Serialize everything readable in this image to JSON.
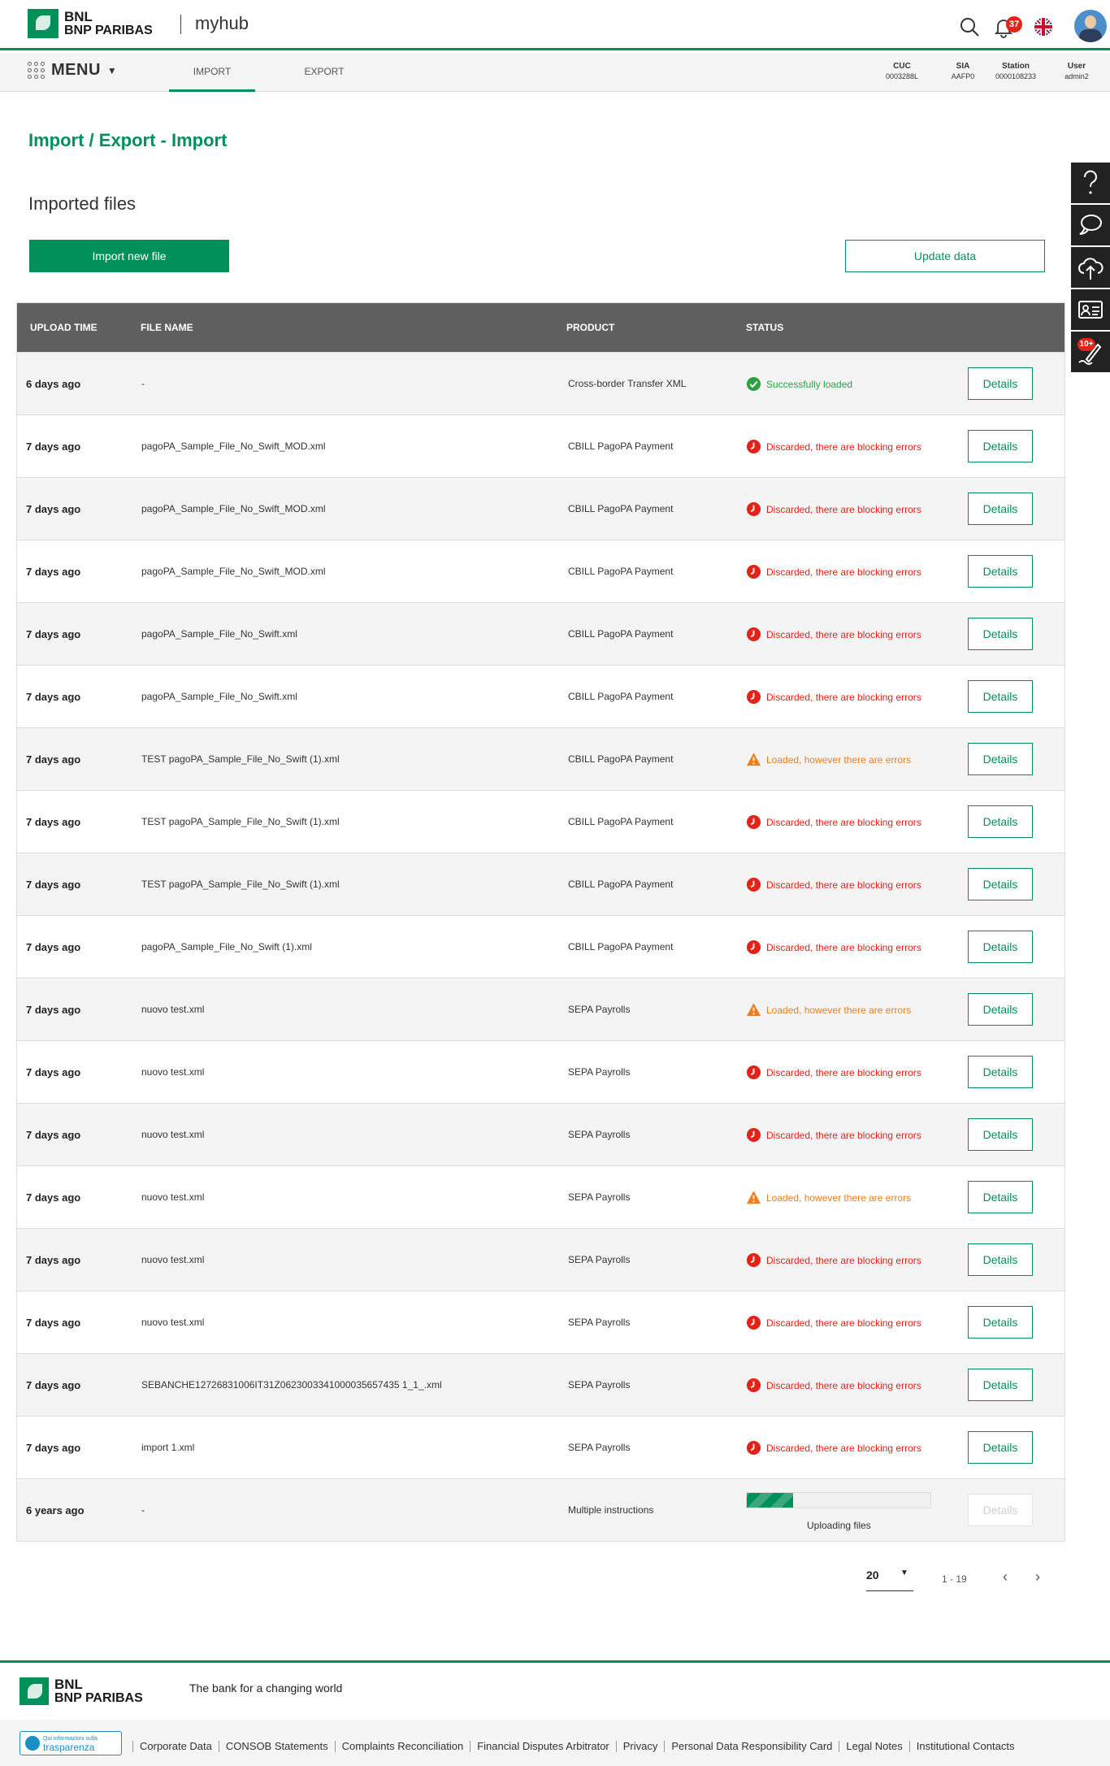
{
  "header": {
    "logo_line1": "BNL",
    "logo_line2": "BNP PARIBAS",
    "app_name": "myhub",
    "notifications_count": "37",
    "icons": [
      "search-icon",
      "bell-icon",
      "uk-flag-icon",
      "avatar"
    ]
  },
  "nav": {
    "menu_label": "MENU",
    "tabs": [
      {
        "label": "IMPORT",
        "active": true
      },
      {
        "label": "EXPORT",
        "active": false
      }
    ],
    "info": [
      {
        "label": "CUC",
        "value": "0003288L"
      },
      {
        "label": "SIA",
        "value": "AAFP0"
      },
      {
        "label": "Station",
        "value": "0000108233"
      },
      {
        "label": "User",
        "value": "admin2"
      }
    ]
  },
  "page": {
    "title": "Import / Export - Import",
    "section_title": "Imported files",
    "import_button": "Import new file",
    "update_button": "Update data"
  },
  "table": {
    "headers": {
      "upload_time": "UPLOAD TIME",
      "file_name": "FILE NAME",
      "product": "PRODUCT",
      "status": "STATUS"
    },
    "details_label": "Details",
    "rows": [
      {
        "time": "6 days ago",
        "file": "-",
        "product": "Cross-border Transfer XML",
        "status": "Successfully loaded",
        "type": "ok"
      },
      {
        "time": "7 days ago",
        "file": "pagoPA_Sample_File_No_Swift_MOD.xml",
        "product": "CBILL PagoPA Payment",
        "status": "Discarded, there are blocking errors",
        "type": "err"
      },
      {
        "time": "7 days ago",
        "file": "pagoPA_Sample_File_No_Swift_MOD.xml",
        "product": "CBILL PagoPA Payment",
        "status": "Discarded, there are blocking errors",
        "type": "err"
      },
      {
        "time": "7 days ago",
        "file": "pagoPA_Sample_File_No_Swift_MOD.xml",
        "product": "CBILL PagoPA Payment",
        "status": "Discarded, there are blocking errors",
        "type": "err"
      },
      {
        "time": "7 days ago",
        "file": "pagoPA_Sample_File_No_Swift.xml",
        "product": "CBILL PagoPA Payment",
        "status": "Discarded, there are blocking errors",
        "type": "err"
      },
      {
        "time": "7 days ago",
        "file": "pagoPA_Sample_File_No_Swift.xml",
        "product": "CBILL PagoPA Payment",
        "status": "Discarded, there are blocking errors",
        "type": "err"
      },
      {
        "time": "7 days ago",
        "file": "TEST pagoPA_Sample_File_No_Swift (1).xml",
        "product": "CBILL PagoPA Payment",
        "status": "Loaded, however there are errors",
        "type": "warn"
      },
      {
        "time": "7 days ago",
        "file": "TEST pagoPA_Sample_File_No_Swift (1).xml",
        "product": "CBILL PagoPA Payment",
        "status": "Discarded, there are blocking errors",
        "type": "err"
      },
      {
        "time": "7 days ago",
        "file": "TEST pagoPA_Sample_File_No_Swift (1).xml",
        "product": "CBILL PagoPA Payment",
        "status": "Discarded, there are blocking errors",
        "type": "err"
      },
      {
        "time": "7 days ago",
        "file": "pagoPA_Sample_File_No_Swift (1).xml",
        "product": "CBILL PagoPA Payment",
        "status": "Discarded, there are blocking errors",
        "type": "err"
      },
      {
        "time": "7 days ago",
        "file": "nuovo test.xml",
        "product": "SEPA Payrolls",
        "status": "Loaded, however there are errors",
        "type": "warn"
      },
      {
        "time": "7 days ago",
        "file": "nuovo test.xml",
        "product": "SEPA Payrolls",
        "status": "Discarded, there are blocking errors",
        "type": "err"
      },
      {
        "time": "7 days ago",
        "file": "nuovo test.xml",
        "product": "SEPA Payrolls",
        "status": "Discarded, there are blocking errors",
        "type": "err"
      },
      {
        "time": "7 days ago",
        "file": "nuovo test.xml",
        "product": "SEPA Payrolls",
        "status": "Loaded, however there are errors",
        "type": "warn"
      },
      {
        "time": "7 days ago",
        "file": "nuovo test.xml",
        "product": "SEPA Payrolls",
        "status": "Discarded, there are blocking errors",
        "type": "err"
      },
      {
        "time": "7 days ago",
        "file": "nuovo test.xml",
        "product": "SEPA Payrolls",
        "status": "Discarded, there are blocking errors",
        "type": "err"
      },
      {
        "time": "7 days ago",
        "file": "SEBANCHE12726831006IT31Z0623003341000035657435 1_1_.xml",
        "product": "SEPA Payrolls",
        "status": "Discarded, there are blocking errors",
        "type": "err"
      },
      {
        "time": "7 days ago",
        "file": "import 1.xml",
        "product": "SEPA Payrolls",
        "status": "Discarded, there are blocking errors",
        "type": "err"
      },
      {
        "time": "6 years ago",
        "file": "-",
        "product": "Multiple instructions",
        "status": "Uploading files",
        "type": "progress",
        "progress": 0.25
      }
    ]
  },
  "pagination": {
    "page_size": "20",
    "range": "1 - 19"
  },
  "sidebar": {
    "items": [
      {
        "icon": "help-icon"
      },
      {
        "icon": "chat-icon"
      },
      {
        "icon": "cloud-upload-icon"
      },
      {
        "icon": "id-card-icon"
      },
      {
        "icon": "signature-icon",
        "badge": "10+"
      }
    ]
  },
  "footer": {
    "tagline": "The bank for a changing world",
    "trasparenza_small": "Qui informazioni sulla",
    "trasparenza_big": "trasparenza",
    "links": [
      "Corporate Data",
      "CONSOB Statements",
      "Complaints Reconciliation",
      "Financial Disputes Arbitrator",
      "Privacy",
      "Personal Data Responsibility Card",
      "Legal Notes",
      "Institutional Contacts"
    ]
  },
  "colors": {
    "brand_green": "#00915a",
    "error_red": "#e2231a",
    "warning_orange": "#f07d1a",
    "success_green": "#2ea043",
    "header_gray": "#5f5f5f"
  }
}
